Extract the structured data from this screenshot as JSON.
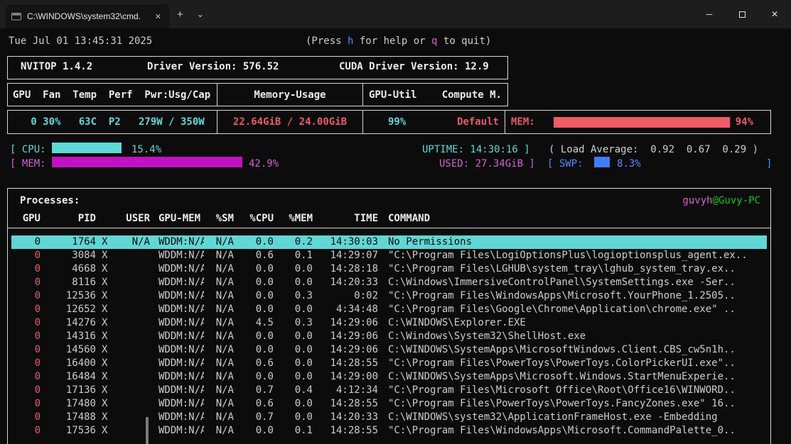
{
  "colors": {
    "cyan": "#61d6d6",
    "red": "#e8596a",
    "magenta": "#d160d1",
    "blue": "#4f8cff",
    "green": "#16c60c",
    "selection_background": "#61d6d6",
    "gauge_red": "#ef5b66",
    "bar_magenta": "#c211c2"
  },
  "titlebar": {
    "tab_title": "C:\\WINDOWS\\system32\\cmd.",
    "tab_close": "✕",
    "new_tab": "+",
    "dropdown": "⌄",
    "minimize": "─",
    "close": "✕"
  },
  "header": {
    "datetime": "Tue Jul 01 13:45:31 2025",
    "help_pre": "(Press ",
    "help_key_h": "h",
    "help_mid": " for help or ",
    "help_key_q": "q",
    "help_post": " to quit)"
  },
  "gpu_panel": {
    "app_version": "NVITOP 1.4.2",
    "driver": "Driver Version: 576.52",
    "cuda": "CUDA Driver Version: 12.9",
    "col_gpu": "GPU  Fan  Temp  Perf  Pwr:Usg/Cap",
    "col_memory": "Memory-Usage",
    "col_util": "GPU-Util",
    "col_compute": "Compute M.",
    "gpu_stats": "   0 30%   63C  P2   279W / 350W",
    "memory_usage": "22.64GiB / 24.00GiB",
    "gpu_util": "99%",
    "compute_mode": "Default",
    "mem_gauge_label": "MEM:",
    "mem_gauge_pct": "94%",
    "mem_gauge_val": 94
  },
  "system": {
    "cpu_prefix": "[ CPU:",
    "cpu_val": 15.4,
    "cpu_pct": "15.4%",
    "uptime": "UPTIME: 14:30:16 ]",
    "load_avg": "( Load Average:  0.92  0.67  0.29 )",
    "mem_prefix": "[ MEM:",
    "mem_val": 42.9,
    "mem_pct": "42.9%",
    "used": "USED: 27.34GiB ]",
    "swp_prefix": "[ SWP:",
    "swp_val": 8.3,
    "swp_pct": "8.3%",
    "swp_suffix": "]"
  },
  "processes": {
    "title": "Processes:",
    "user": "guvyh",
    "host": "@Guvy-PC",
    "columns": {
      "gpu": "GPU",
      "pid": "PID",
      "user": "USER",
      "gpu_mem": "GPU-MEM",
      "sm": "%SM",
      "cpu": "%CPU",
      "mem": "%MEM",
      "time": "TIME",
      "command": "COMMAND"
    },
    "rows": [
      {
        "gpu": "0",
        "pid": "1764",
        "type": "X",
        "user": "N/A",
        "gpu_mem": "WDDM:N/A",
        "sm": "N/A",
        "cpu": "0.0",
        "mem": "0.2",
        "time": "14:30:03",
        "command": "No Permissions",
        "selected": true
      },
      {
        "gpu": "0",
        "pid": "3084",
        "type": "X",
        "user": "",
        "gpu_mem": "WDDM:N/A",
        "sm": "N/A",
        "cpu": "0.6",
        "mem": "0.1",
        "time": "14:29:07",
        "command": "\"C:\\Program Files\\LogiOptionsPlus\\logioptionsplus_agent.ex..",
        "selected": false
      },
      {
        "gpu": "0",
        "pid": "4668",
        "type": "X",
        "user": "",
        "gpu_mem": "WDDM:N/A",
        "sm": "N/A",
        "cpu": "0.0",
        "mem": "0.0",
        "time": "14:28:18",
        "command": "\"C:\\Program Files\\LGHUB\\system_tray\\lghub_system_tray.ex..",
        "selected": false
      },
      {
        "gpu": "0",
        "pid": "8116",
        "type": "X",
        "user": "",
        "gpu_mem": "WDDM:N/A",
        "sm": "N/A",
        "cpu": "0.0",
        "mem": "0.0",
        "time": "14:20:33",
        "command": "C:\\Windows\\ImmersiveControlPanel\\SystemSettings.exe -Ser..",
        "selected": false
      },
      {
        "gpu": "0",
        "pid": "12536",
        "type": "X",
        "user": "",
        "gpu_mem": "WDDM:N/A",
        "sm": "N/A",
        "cpu": "0.0",
        "mem": "0.3",
        "time": "0:02",
        "command": "\"C:\\Program Files\\WindowsApps\\Microsoft.YourPhone_1.2505..",
        "selected": false
      },
      {
        "gpu": "0",
        "pid": "12652",
        "type": "X",
        "user": "",
        "gpu_mem": "WDDM:N/A",
        "sm": "N/A",
        "cpu": "0.0",
        "mem": "0.0",
        "time": "4:34:48",
        "command": "\"C:\\Program Files\\Google\\Chrome\\Application\\chrome.exe\" ..",
        "selected": false
      },
      {
        "gpu": "0",
        "pid": "14276",
        "type": "X",
        "user": "",
        "gpu_mem": "WDDM:N/A",
        "sm": "N/A",
        "cpu": "4.5",
        "mem": "0.3",
        "time": "14:29:06",
        "command": "C:\\WINDOWS\\Explorer.EXE",
        "selected": false
      },
      {
        "gpu": "0",
        "pid": "14316",
        "type": "X",
        "user": "",
        "gpu_mem": "WDDM:N/A",
        "sm": "N/A",
        "cpu": "0.0",
        "mem": "0.0",
        "time": "14:29:06",
        "command": "C:\\Windows\\System32\\ShellHost.exe",
        "selected": false
      },
      {
        "gpu": "0",
        "pid": "14560",
        "type": "X",
        "user": "",
        "gpu_mem": "WDDM:N/A",
        "sm": "N/A",
        "cpu": "0.0",
        "mem": "0.0",
        "time": "14:29:06",
        "command": "C:\\WINDOWS\\SystemApps\\MicrosoftWindows.Client.CBS_cw5n1h..",
        "selected": false
      },
      {
        "gpu": "0",
        "pid": "16400",
        "type": "X",
        "user": "",
        "gpu_mem": "WDDM:N/A",
        "sm": "N/A",
        "cpu": "0.6",
        "mem": "0.0",
        "time": "14:28:55",
        "command": "\"C:\\Program Files\\PowerToys\\PowerToys.ColorPickerUI.exe\"..",
        "selected": false
      },
      {
        "gpu": "0",
        "pid": "16484",
        "type": "X",
        "user": "",
        "gpu_mem": "WDDM:N/A",
        "sm": "N/A",
        "cpu": "0.0",
        "mem": "0.0",
        "time": "14:29:00",
        "command": "C:\\WINDOWS\\SystemApps\\Microsoft.Windows.StartMenuExperie..",
        "selected": false
      },
      {
        "gpu": "0",
        "pid": "17136",
        "type": "X",
        "user": "",
        "gpu_mem": "WDDM:N/A",
        "sm": "N/A",
        "cpu": "0.7",
        "mem": "0.4",
        "time": "4:12:34",
        "command": "\"C:\\Program Files\\Microsoft Office\\Root\\Office16\\WINWORD..",
        "selected": false
      },
      {
        "gpu": "0",
        "pid": "17480",
        "type": "X",
        "user": "",
        "gpu_mem": "WDDM:N/A",
        "sm": "N/A",
        "cpu": "0.6",
        "mem": "0.0",
        "time": "14:28:55",
        "command": "\"C:\\Program Files\\PowerToys\\PowerToys.FancyZones.exe\" 16..",
        "selected": false
      },
      {
        "gpu": "0",
        "pid": "17488",
        "type": "X",
        "user": "",
        "gpu_mem": "WDDM:N/A",
        "sm": "N/A",
        "cpu": "0.7",
        "mem": "0.0",
        "time": "14:20:33",
        "command": "C:\\WINDOWS\\system32\\ApplicationFrameHost.exe -Embedding",
        "selected": false
      },
      {
        "gpu": "0",
        "pid": "17536",
        "type": "X",
        "user": "",
        "gpu_mem": "WDDM:N/A",
        "sm": "N/A",
        "cpu": "0.0",
        "mem": "0.1",
        "time": "14:28:55",
        "command": "\"C:\\Program Files\\WindowsApps\\Microsoft.CommandPalette_0..",
        "selected": false
      }
    ]
  }
}
